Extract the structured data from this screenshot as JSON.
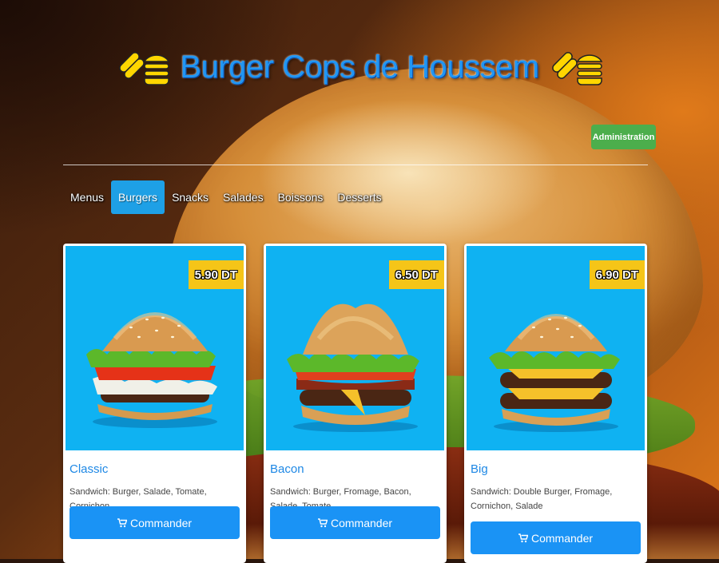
{
  "header": {
    "title": "Burger Cops de Houssem",
    "logo_icon": "hotdog-burger-icon"
  },
  "admin": {
    "label": "Administration"
  },
  "nav": {
    "items": [
      {
        "label": "Menus",
        "active": false
      },
      {
        "label": "Burgers",
        "active": true
      },
      {
        "label": "Snacks",
        "active": false
      },
      {
        "label": "Salades",
        "active": false
      },
      {
        "label": "Boissons",
        "active": false
      },
      {
        "label": "Desserts",
        "active": false
      }
    ]
  },
  "products": [
    {
      "name": "Classic",
      "price": "5.90 DT",
      "description": "Sandwich: Burger, Salade, Tomate, Cornichon",
      "button": "Commander"
    },
    {
      "name": "Bacon",
      "price": "6.50 DT",
      "description": "Sandwich: Burger, Fromage, Bacon, Salade, Tomate",
      "button": "Commander"
    },
    {
      "name": "Big",
      "price": "6.90 DT",
      "description": "Sandwich: Double Burger, Fromage, Cornichon, Salade",
      "button": "Commander"
    }
  ],
  "colors": {
    "title": "#2196f3",
    "admin_button": "#4cae4c",
    "nav_active": "#1ea0e6",
    "card_media": "#0fb2f2",
    "price_badge": "#f5c518",
    "order_button": "#1a93f5"
  }
}
